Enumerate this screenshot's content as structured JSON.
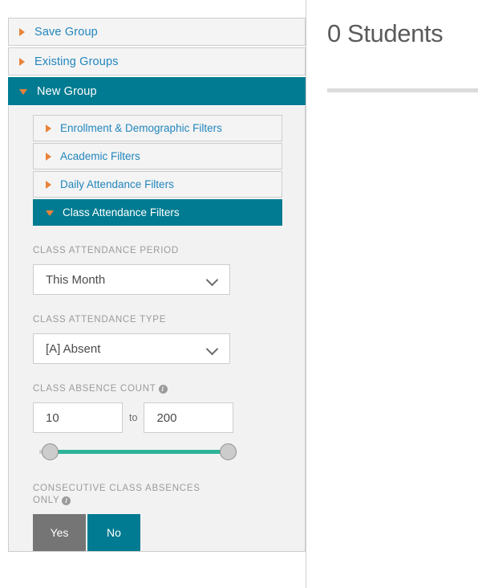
{
  "panel": {
    "accordions": [
      {
        "label": "Save Group",
        "expanded": false,
        "marker": "triangle-right-icon"
      },
      {
        "label": "Existing Groups",
        "expanded": false,
        "marker": "triangle-right-icon"
      },
      {
        "label": "New Group",
        "expanded": true,
        "marker": "triangle-down-icon"
      }
    ],
    "sub_accordions": [
      {
        "label": "Enrollment & Demographic Filters",
        "expanded": false,
        "marker": "triangle-right-icon"
      },
      {
        "label": "Academic Filters",
        "expanded": false,
        "marker": "triangle-right-icon"
      },
      {
        "label": "Daily Attendance Filters",
        "expanded": false,
        "marker": "triangle-right-icon"
      },
      {
        "label": "Class Attendance Filters",
        "expanded": true,
        "marker": "triangle-down-icon"
      }
    ],
    "fields": {
      "attendance_period": {
        "label": "CLASS ATTENDANCE PERIOD",
        "value": "This Month",
        "chevron": "chevron-down-icon"
      },
      "attendance_type": {
        "label": "CLASS ATTENDANCE TYPE",
        "value": "[A] Absent",
        "chevron": "chevron-down-icon"
      },
      "absence_count": {
        "label": "CLASS ABSENCE COUNT",
        "info": "info-icon",
        "info_glyph": "i",
        "min_value": "10",
        "max_value": "200",
        "separator": "to",
        "slider": {
          "min_pos_pct": 0,
          "max_pos_pct": 100
        }
      },
      "consecutive_only": {
        "label": "CONSECUTIVE CLASS ABSENCES ONLY",
        "info": "info-icon",
        "info_glyph": "i",
        "options": [
          {
            "label": "Yes",
            "selected": false
          },
          {
            "label": "No",
            "selected": true
          }
        ]
      }
    }
  },
  "summary": {
    "student_count_text": "0 Students"
  },
  "colors": {
    "teal": "#007b91",
    "orange": "#e8833a",
    "link_blue": "#2186bd",
    "slider_green": "#2eb39a",
    "gray_off": "#757575",
    "panel_bg": "#f2f2f2"
  }
}
